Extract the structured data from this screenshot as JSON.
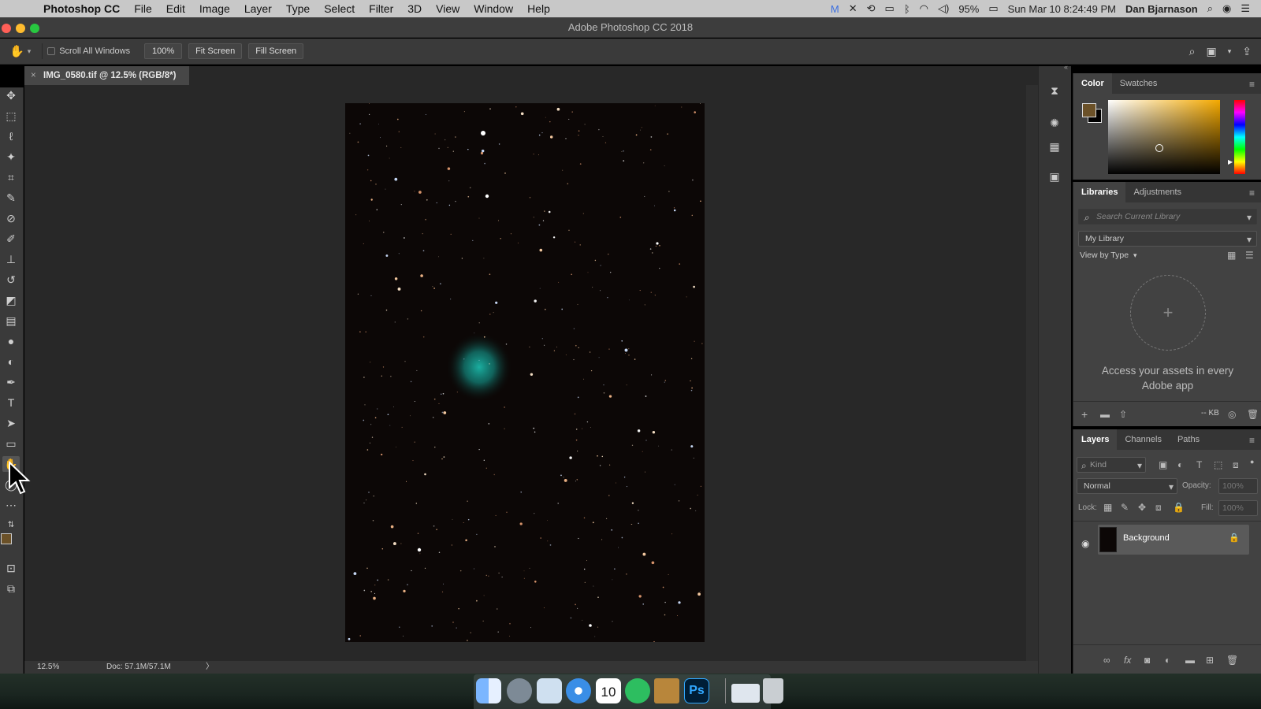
{
  "menubar": {
    "apple_icon": "apple-logo-icon",
    "app_name": "Photoshop CC",
    "menus": [
      "File",
      "Edit",
      "Image",
      "Layer",
      "Type",
      "Select",
      "Filter",
      "3D",
      "View",
      "Window",
      "Help"
    ],
    "battery": "95%",
    "datetime": "Sun Mar 10  8:24:49 PM",
    "user": "Dan Bjarnason"
  },
  "window": {
    "title": "Adobe Photoshop CC 2018"
  },
  "options_bar": {
    "scroll_all_windows": "Scroll All Windows",
    "zoom_100": "100%",
    "fit_screen": "Fit Screen",
    "fill_screen": "Fill Screen"
  },
  "document": {
    "tab_title": "IMG_0580.tif @ 12.5% (RGB/8*)",
    "close": "×",
    "zoom": "12.5%",
    "doc_size": "Doc: 57.1M/57.1M",
    "status_arrow": "〉"
  },
  "color_panel": {
    "tabs": [
      "Color",
      "Swatches"
    ],
    "foreground": "#6b5128",
    "hue": "#f4a900"
  },
  "libraries_panel": {
    "tabs": [
      "Libraries",
      "Adjustments"
    ],
    "search_placeholder": "Search Current Library",
    "library": "My Library",
    "view_by": "View by Type",
    "empty_plus": "+",
    "empty_message": "Access your assets in every Adobe app",
    "size": "-- KB"
  },
  "layers_panel": {
    "tabs": [
      "Layers",
      "Channels",
      "Paths"
    ],
    "kind": "Kind",
    "blend_mode": "Normal",
    "opacity_label": "Opacity:",
    "opacity_value": "100%",
    "lock_label": "Lock:",
    "fill_label": "Fill:",
    "fill_value": "100%",
    "layer_name": "Background"
  },
  "dock": {
    "calendar_day": "10",
    "ps_label": "Ps"
  }
}
